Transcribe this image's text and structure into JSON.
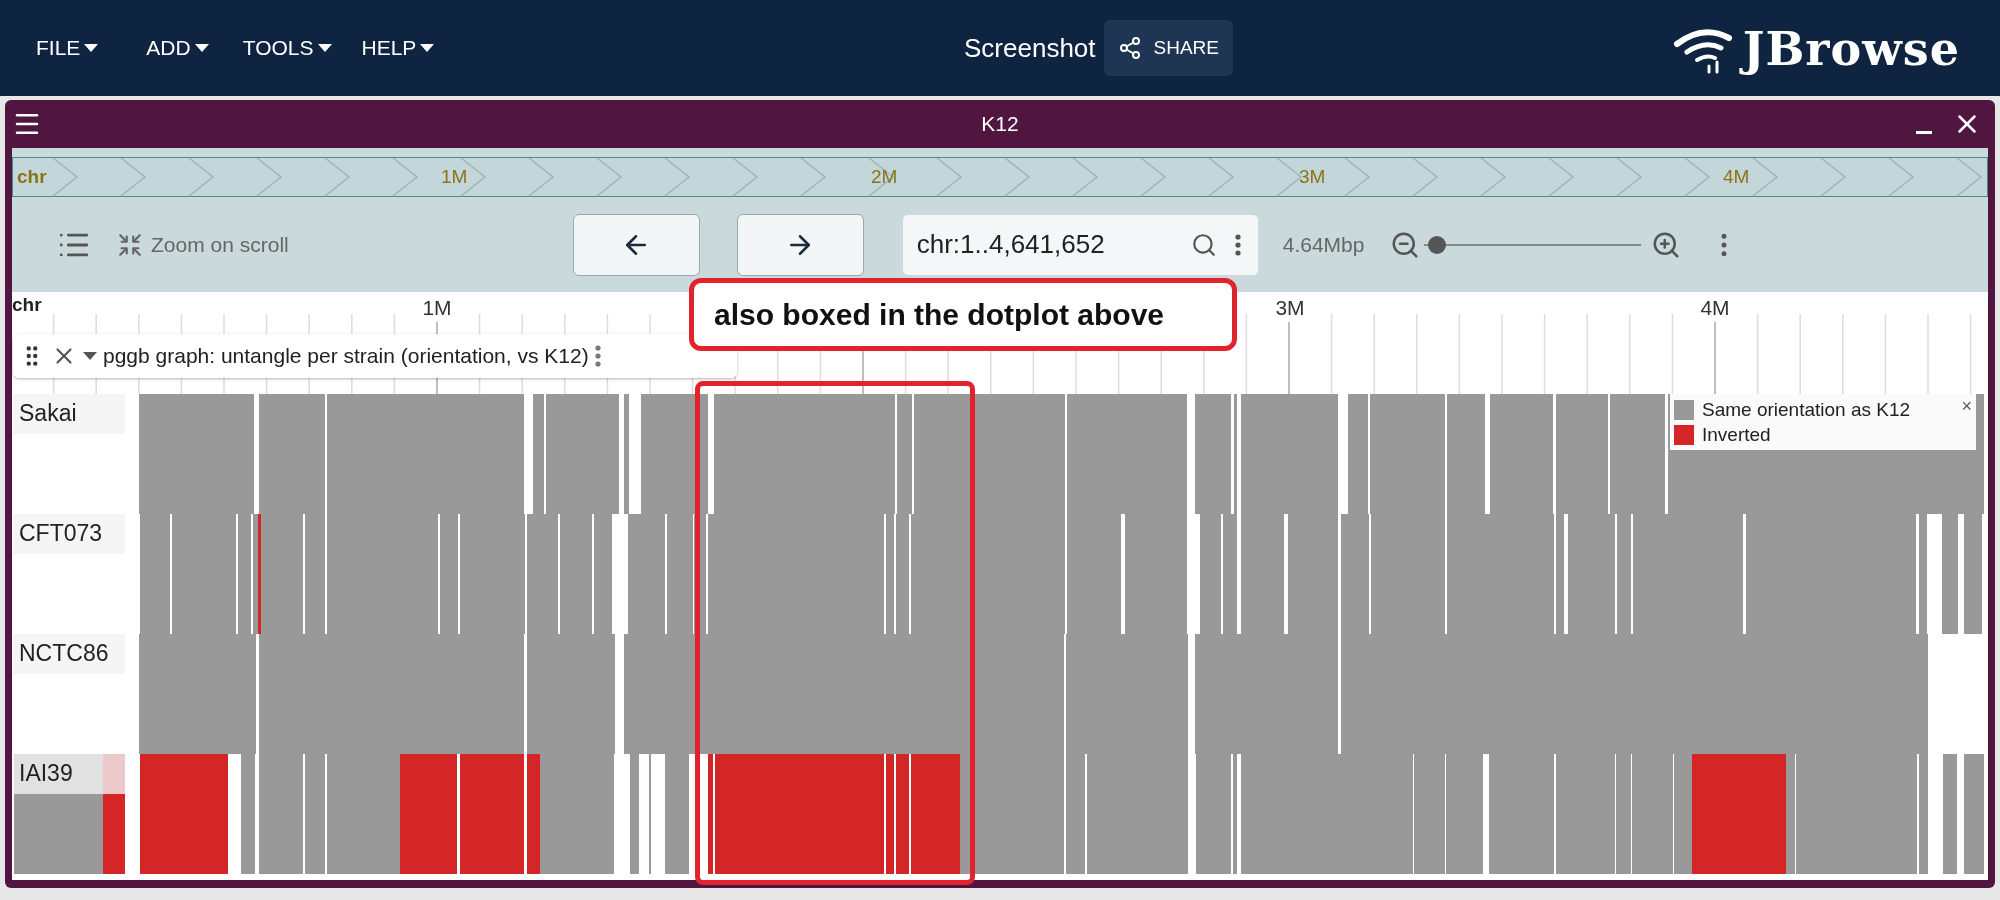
{
  "menu": [
    {
      "label": "FILE"
    },
    {
      "label": "ADD"
    },
    {
      "label": "TOOLS"
    },
    {
      "label": "HELP"
    }
  ],
  "session_title": "Screenshot",
  "share": "SHARE",
  "logo": "JBrowse",
  "view": {
    "title": "K12",
    "overview": {
      "chrom": "chr",
      "ticks": [
        "1M",
        "2M",
        "3M",
        "4M"
      ]
    },
    "toolbar": {
      "zoom_on_scroll": "Zoom on scroll",
      "location": "chr:1..4,641,652",
      "span": "4.64Mbp",
      "zoom": {
        "level": 0.06
      }
    },
    "ruler": {
      "chrom": "chr",
      "ticks": [
        "1M",
        "3M",
        "4M"
      ]
    },
    "track": {
      "title": "pggb graph: untangle per strain (orientation, vs K12)",
      "rows": [
        {
          "name": "Sakai"
        },
        {
          "name": "CFT073"
        },
        {
          "name": "NCTC86"
        },
        {
          "name": "IAI39"
        }
      ],
      "legend": [
        {
          "label": "Same orientation as K12",
          "color": "#999999"
        },
        {
          "label": "Inverted",
          "color": "#d42626"
        }
      ],
      "legend_close": "×"
    },
    "annotation": "also boxed in the dotplot above"
  }
}
